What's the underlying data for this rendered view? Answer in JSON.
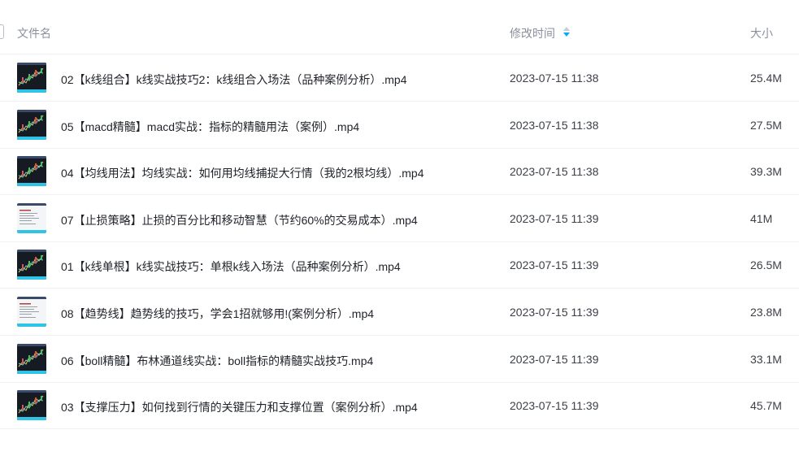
{
  "header": {
    "name_label": "文件名",
    "time_label": "修改时间",
    "size_label": "大小"
  },
  "colors": {
    "accent": "#06a7ff",
    "thumb_bar": "#2fc3e6"
  },
  "files": [
    {
      "name": "02【k线组合】k线实战技巧2：k线组合入场法（品种案例分析）.mp4",
      "time": "2023-07-15 11:38",
      "size": "25.4M",
      "thumb": "dark"
    },
    {
      "name": "05【macd精髓】macd实战：指标的精髓用法（案例）.mp4",
      "time": "2023-07-15 11:38",
      "size": "27.5M",
      "thumb": "dark"
    },
    {
      "name": "04【均线用法】均线实战：如何用均线捕捉大行情（我的2根均线）.mp4",
      "time": "2023-07-15 11:38",
      "size": "39.3M",
      "thumb": "dark"
    },
    {
      "name": "07【止损策略】止损的百分比和移动智慧（节约60%的交易成本）.mp4",
      "time": "2023-07-15 11:39",
      "size": "41M",
      "thumb": "light"
    },
    {
      "name": "01【k线单根】k线实战技巧：单根k线入场法（品种案例分析）.mp4",
      "time": "2023-07-15 11:39",
      "size": "26.5M",
      "thumb": "dark"
    },
    {
      "name": "08【趋势线】趋势线的技巧，学会1招就够用!(案例分析）.mp4",
      "time": "2023-07-15 11:39",
      "size": "23.8M",
      "thumb": "light"
    },
    {
      "name": "06【boll精髓】布林通道线实战：boll指标的精髓实战技巧.mp4",
      "time": "2023-07-15 11:39",
      "size": "33.1M",
      "thumb": "dark"
    },
    {
      "name": "03【支撑压力】如何找到行情的关键压力和支撑位置（案例分析）.mp4",
      "time": "2023-07-15 11:39",
      "size": "45.7M",
      "thumb": "dark"
    }
  ]
}
